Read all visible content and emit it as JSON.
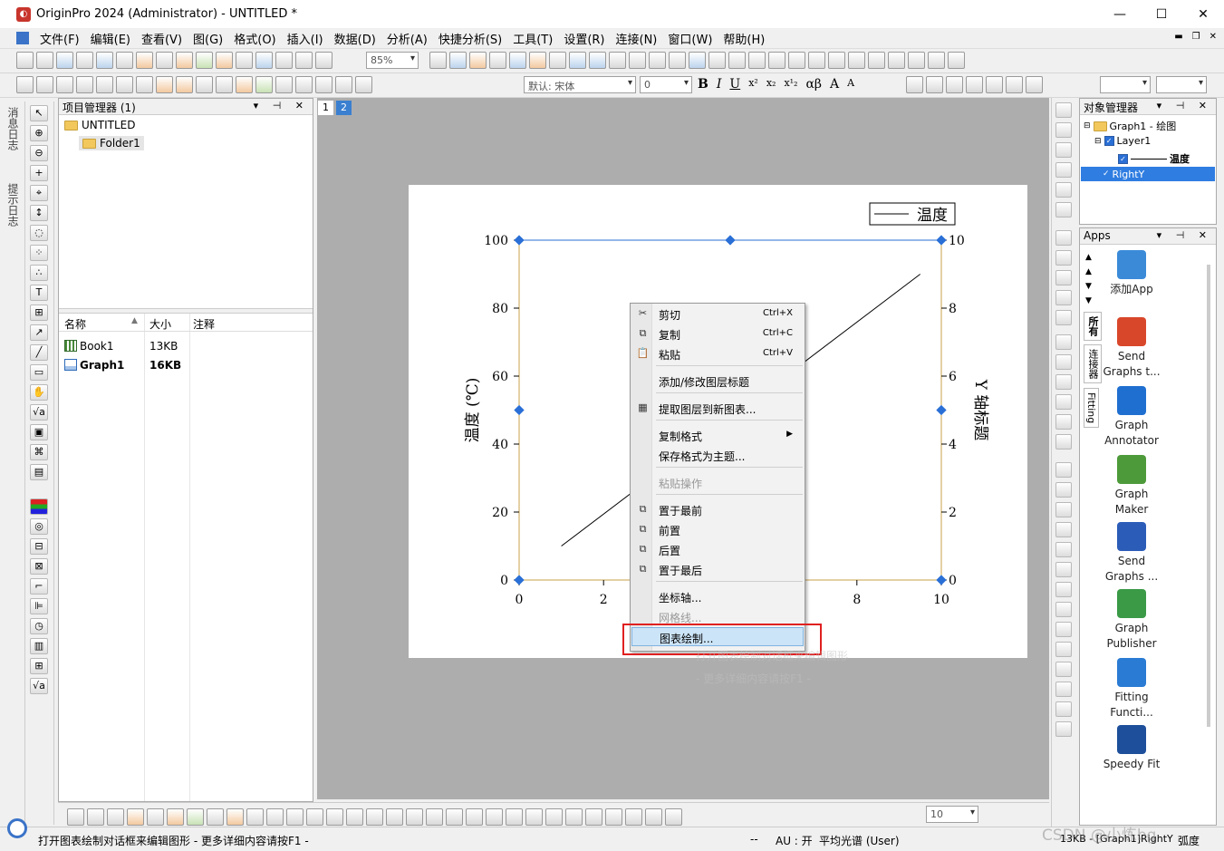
{
  "window": {
    "title": "OriginPro 2024 (Administrator) - UNTITLED *",
    "controls": [
      "—",
      "☐",
      "✕"
    ]
  },
  "menu": [
    "文件(F)",
    "编辑(E)",
    "查看(V)",
    "图(G)",
    "格式(O)",
    "插入(I)",
    "数据(D)",
    "分析(A)",
    "快捷分析(S)",
    "工具(T)",
    "设置(R)",
    "连接(N)",
    "窗口(W)",
    "帮助(H)"
  ],
  "toolbar": {
    "zoom": "85%",
    "font": "默认: 宋体",
    "font_size": "0",
    "bold": "B",
    "italic": "I",
    "underline": "U",
    "greek": "αβ",
    "bottom_size": "10"
  },
  "side_tabs": [
    "消息日志",
    "提示日志"
  ],
  "project_manager": {
    "title": "项目管理器 (1)",
    "root": "UNTITLED",
    "folder": "Folder1",
    "columns": [
      "名称",
      "大小",
      "注释"
    ],
    "files": [
      {
        "name": "Book1",
        "size": "13KB",
        "type": "book"
      },
      {
        "name": "Graph1",
        "size": "16KB",
        "type": "graph"
      }
    ]
  },
  "page_tabs": [
    "1",
    "2"
  ],
  "graph": {
    "legend": "温度",
    "ylabel_left": "温度 (℃)",
    "ylabel_right": "Y 轴标题",
    "yticks_left": [
      "100",
      "80",
      "60",
      "40",
      "20",
      "0"
    ],
    "yticks_right": [
      "10",
      "8",
      "6",
      "4",
      "2",
      "0"
    ],
    "xticks": [
      "0",
      "2",
      "8",
      "10"
    ]
  },
  "chart_data": {
    "type": "line",
    "series": [
      {
        "name": "温度",
        "x": [
          1,
          9.5
        ],
        "y": [
          10,
          90
        ]
      }
    ],
    "xlim": [
      0,
      10
    ],
    "ylim": [
      0,
      100
    ],
    "ylim_right": [
      0,
      10
    ],
    "ylabel": "温度 (℃)",
    "y2label": "Y 轴标题",
    "legend_position": "top-right"
  },
  "context_menu": {
    "items": [
      {
        "label": "剪切",
        "shortcut": "Ctrl+X",
        "icon": "✂"
      },
      {
        "label": "复制",
        "shortcut": "Ctrl+C",
        "icon": "⧉"
      },
      {
        "label": "粘贴",
        "shortcut": "Ctrl+V",
        "icon": "📋"
      },
      {
        "label": "添加/修改图层标题"
      },
      {
        "label": "提取图层到新图表...",
        "icon": "▦"
      },
      {
        "label": "复制格式",
        "submenu": "▶"
      },
      {
        "label": "保存格式为主题..."
      },
      {
        "label": "粘贴操作"
      },
      {
        "label": "置于最前",
        "icon": "⧉"
      },
      {
        "label": "前置",
        "icon": "⧉"
      },
      {
        "label": "后置",
        "icon": "⧉"
      },
      {
        "label": "置于最后",
        "icon": "⧉"
      },
      {
        "label": "坐标轴..."
      },
      {
        "label": "网格线..."
      },
      {
        "label": "图表绘制..."
      }
    ],
    "ghost_line1": "打开图表绘制对话框来编辑图形",
    "ghost_line2": "- 更多详细内容请按F1 -"
  },
  "object_manager": {
    "title": "对象管理器",
    "graph": "Graph1 - 绘图",
    "layer": "Layer1",
    "plot": "温度",
    "right_y": "RightY"
  },
  "apps": {
    "title": "Apps",
    "tabs": [
      "所有",
      "连接器",
      "Fitting"
    ],
    "items": [
      {
        "label": "添加App",
        "color": "#3a8ad8"
      },
      {
        "label": "Send Graphs t...",
        "color": "#d9472b"
      },
      {
        "label": "Graph Annotator",
        "color": "#1f6fd0"
      },
      {
        "label": "Graph Maker",
        "color": "#4d9a3a"
      },
      {
        "label": "Send Graphs ...",
        "color": "#2b5cb8"
      },
      {
        "label": "Graph Publisher",
        "color": "#3a9a46"
      },
      {
        "label": "Fitting Functi...",
        "color": "#2a7bd3"
      },
      {
        "label": "Speedy Fit",
        "color": "#1d4f9a"
      }
    ]
  },
  "status": {
    "message": "打开图表绘制对话框来编辑图形 - 更多详细内容请按F1 -",
    "mode": "--",
    "au": "AU : 开",
    "theme": "平均光谱 (User)",
    "right": "13KB - [Graph1]RightY",
    "degree": "弧度",
    "watermark": "CSDN @小炼bg"
  }
}
